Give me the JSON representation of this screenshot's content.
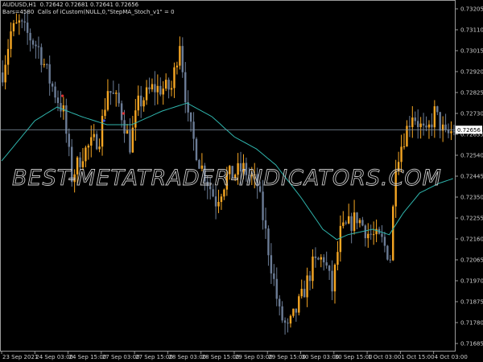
{
  "header": {
    "symbol_line": "AUDUSD,H1  0.72642 0.72681 0.72641 0.72656",
    "bars_line": "Bars=4580  Calls of iCustom(NULL,0,\"StepMA_Stoch_v1\" = 0"
  },
  "watermark": "BEST-METATRADER-INDICATORS.COM",
  "colors": {
    "bull": "#f5a623",
    "bear": "#6b7c96",
    "ma": "#2fb5ad",
    "grid": "#9a9a9a",
    "price_line": "#8899aa"
  },
  "chart_data": {
    "type": "candlestick",
    "symbol": "AUDUSD",
    "timeframe": "H1",
    "current_price": "0.72656",
    "current_price_value": 0.72656,
    "ylim": [
      0.7164,
      0.7336
    ],
    "y_ticks": [
      "0.73205",
      "0.73110",
      "0.73015",
      "0.72920",
      "0.72825",
      "0.72730",
      "0.72635",
      "0.72540",
      "0.72445",
      "0.72350",
      "0.72255",
      "0.72160",
      "0.72065",
      "0.71970",
      "0.71875",
      "0.71780",
      "0.71685"
    ],
    "x_ticks": [
      {
        "bar": 0,
        "label": "23 Sep 2021"
      },
      {
        "bar": 12,
        "label": "24 Sep 03:00"
      },
      {
        "bar": 24,
        "label": "24 Sep 15:00"
      },
      {
        "bar": 36,
        "label": "27 Sep 03:00"
      },
      {
        "bar": 48,
        "label": "27 Sep 15:00"
      },
      {
        "bar": 60,
        "label": "28 Sep 03:00"
      },
      {
        "bar": 72,
        "label": "28 Sep 15:00"
      },
      {
        "bar": 84,
        "label": "29 Sep 03:00"
      },
      {
        "bar": 96,
        "label": "29 Sep 15:00"
      },
      {
        "bar": 108,
        "label": "30 Sep 03:00"
      },
      {
        "bar": 120,
        "label": "30 Sep 15:00"
      },
      {
        "bar": 132,
        "label": "1 Oct 03:00"
      },
      {
        "bar": 144,
        "label": "1 Oct 15:00"
      },
      {
        "bar": 156,
        "label": "4 Oct 03:00"
      }
    ],
    "bars": 164,
    "close_path": [
      [
        0,
        0.72916
      ],
      [
        3,
        0.73099
      ],
      [
        6,
        0.73136
      ],
      [
        13,
        0.73026
      ],
      [
        17,
        0.7288
      ],
      [
        22,
        0.72734
      ],
      [
        25,
        0.72441
      ],
      [
        29,
        0.72551
      ],
      [
        35,
        0.72624
      ],
      [
        38,
        0.72843
      ],
      [
        42,
        0.7277
      ],
      [
        46,
        0.72588
      ],
      [
        49,
        0.7277
      ],
      [
        54,
        0.72843
      ],
      [
        61,
        0.72843
      ],
      [
        64,
        0.73063
      ],
      [
        67,
        0.72697
      ],
      [
        71,
        0.72514
      ],
      [
        77,
        0.72332
      ],
      [
        81,
        0.72441
      ],
      [
        87,
        0.72478
      ],
      [
        92,
        0.72405
      ],
      [
        94,
        0.72259
      ],
      [
        97,
        0.72039
      ],
      [
        100,
        0.7182
      ],
      [
        103,
        0.71747
      ],
      [
        108,
        0.71893
      ],
      [
        112,
        0.72039
      ],
      [
        116,
        0.72076
      ],
      [
        119,
        0.7193
      ],
      [
        122,
        0.72186
      ],
      [
        128,
        0.72259
      ],
      [
        132,
        0.72186
      ],
      [
        137,
        0.72149
      ],
      [
        140,
        0.72076
      ],
      [
        142,
        0.72514
      ],
      [
        145,
        0.72624
      ],
      [
        148,
        0.72734
      ],
      [
        153,
        0.72624
      ],
      [
        156,
        0.72734
      ],
      [
        160,
        0.72624
      ],
      [
        163,
        0.72656
      ]
    ],
    "ma_series": {
      "name": "StepMA_Stoch_v1",
      "points": [
        [
          0,
          0.72514
        ],
        [
          12,
          0.72697
        ],
        [
          20,
          0.72759
        ],
        [
          29,
          0.72715
        ],
        [
          38,
          0.72679
        ],
        [
          47,
          0.72679
        ],
        [
          58,
          0.72741
        ],
        [
          67,
          0.72777
        ],
        [
          76,
          0.72715
        ],
        [
          84,
          0.72624
        ],
        [
          92,
          0.72569
        ],
        [
          99,
          0.72496
        ],
        [
          108,
          0.7235
        ],
        [
          116,
          0.72204
        ],
        [
          121,
          0.72157
        ],
        [
          125,
          0.72179
        ],
        [
          134,
          0.72204
        ],
        [
          140,
          0.72179
        ],
        [
          145,
          0.72277
        ],
        [
          151,
          0.72369
        ],
        [
          158,
          0.72413
        ],
        [
          163,
          0.72434
        ]
      ]
    },
    "signals": [
      {
        "bar": 22,
        "price": 0.7281,
        "color": "#e03030"
      },
      {
        "bar": 37,
        "price": 0.72697,
        "color": "#3050e0"
      },
      {
        "bar": 44,
        "price": 0.7273,
        "color": "#e03030"
      }
    ]
  }
}
